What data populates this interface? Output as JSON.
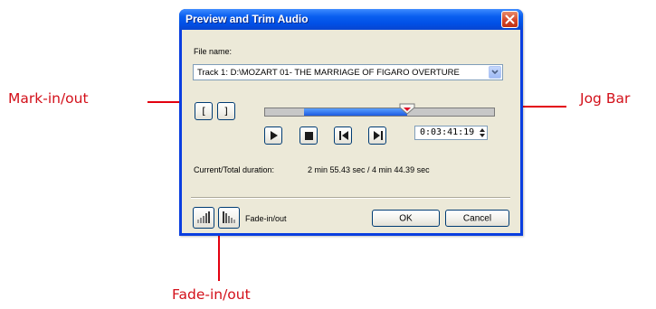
{
  "dialog": {
    "title": "Preview and Trim Audio",
    "file_label": "File name:",
    "file_value": "Track 1: D:\\MOZART 01- THE MARRIAGE OF FIGARO OVERTURE",
    "time_value": "0:03:41:19",
    "duration_label": "Current/Total duration:",
    "duration_value": "2 min 55.43 sec / 4 min 44.39 sec",
    "fade_label": "Fade-in/out",
    "ok_label": "OK",
    "cancel_label": "Cancel",
    "mark_in_label": "[",
    "mark_out_label": "]",
    "jog_position": 0.62,
    "jog_selection_start": 0.17
  },
  "callouts": {
    "mark": "Mark-in/out",
    "jog": "Jog Bar",
    "fade": "Fade-in/out"
  },
  "colors": {
    "accent_red": "#e3000f",
    "title_blue": "#0a5ff0",
    "selection_blue": "#1e5be0"
  }
}
